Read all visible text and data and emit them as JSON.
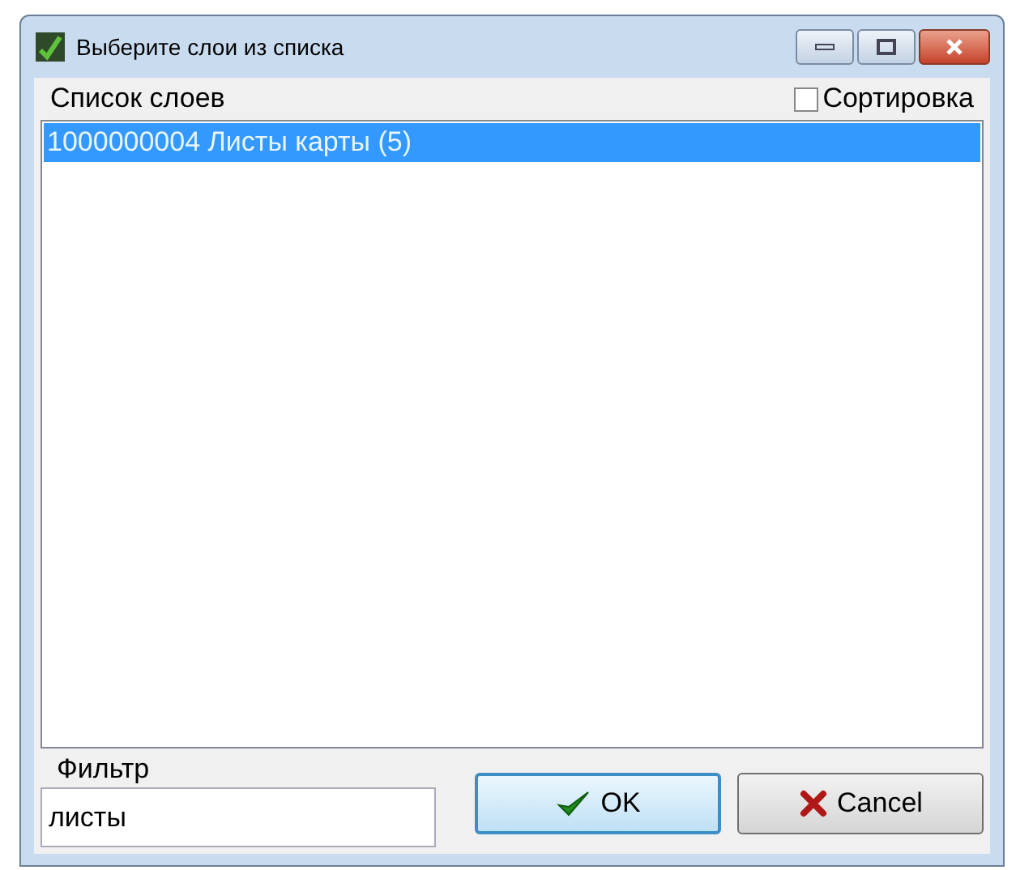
{
  "window": {
    "title": "Выберите слои из списка"
  },
  "list": {
    "label": "Список слоев",
    "items": [
      {
        "text": "1000000004 Листы карты (5)",
        "selected": true
      }
    ]
  },
  "sort": {
    "label": "Сортировка",
    "checked": false
  },
  "filter": {
    "label": "Фильтр",
    "value": "листы"
  },
  "buttons": [
    {
      "kind": "ok",
      "label": "OK",
      "focused": true
    },
    {
      "kind": "cancel",
      "label": "Cancel",
      "focused": false
    }
  ]
}
